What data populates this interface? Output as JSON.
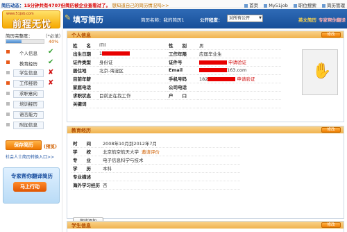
{
  "topbar": {
    "news_label": "简历动态：",
    "news_highlight": "15分钟共有4707份简历被企业查看过了。",
    "news_hint": "想知道自己的简历情况吗>>",
    "links": [
      "首页",
      "My51job",
      "职位搜索",
      "简历管理"
    ]
  },
  "sidebar": {
    "logo_site": "www.51job.com",
    "logo_brand": "前程无忧",
    "completion_label": "简历完整度：",
    "completion_required": "（*必填）",
    "progress": 0.4,
    "progress_text": "40%",
    "items": [
      {
        "label": "个人信息",
        "required": true,
        "status": "✔"
      },
      {
        "label": "教育经历",
        "required": true,
        "status": "✔"
      },
      {
        "label": "学生信息",
        "required": false,
        "status": "✘"
      },
      {
        "label": "工作经验",
        "required": true,
        "status": "✘"
      },
      {
        "label": "求职意向",
        "required": false,
        "status": ""
      },
      {
        "label": "培训经历",
        "required": false,
        "status": ""
      },
      {
        "label": "语言能力",
        "required": false,
        "status": ""
      },
      {
        "label": "附加信息",
        "required": false,
        "status": ""
      }
    ],
    "save_button": "保存简历",
    "preview_link": "(预览)",
    "social_link": "社会人士简历转换入口>>",
    "ad_title": "专家帮你翻译简历",
    "ad_button": "马上行动"
  },
  "header": {
    "title": "填写简历",
    "resume_name_label": "简历名称：",
    "resume_name": "我的简历1",
    "public_label": "公开程度：",
    "public_value": "对所有公开",
    "english_resume": "英文简历",
    "expert_help": "专家帮你翻译"
  },
  "personal": {
    "section_title": "个人信息",
    "edit_label": "修改",
    "rows": [
      {
        "k1": "姓　　名",
        "v1": "ITIl",
        "k2": "性　　别",
        "v2": "男"
      },
      {
        "k1": "出生日期",
        "v1": "1",
        "k2": "工作年限",
        "v2": "应届毕业生"
      },
      {
        "k1": "证件类型",
        "v1": "身份证",
        "k2": "证件号",
        "v2": ""
      },
      {
        "k1": "居住地",
        "v1": "北京-海淀区",
        "k2": "Email",
        "v2": "163.com"
      },
      {
        "k1": "目前年薪",
        "v1": "",
        "k2": "手机号码",
        "v2": "182"
      },
      {
        "k1": "家庭电话",
        "v1": "",
        "k2": "公司电话",
        "v2": ""
      },
      {
        "k1": "求职状态",
        "v1": "目前正在找工作",
        "k2": "户　　口",
        "v2": ""
      },
      {
        "k1": "关键词",
        "v1": "",
        "k2": "",
        "v2": ""
      }
    ],
    "verify_label": "申请验证"
  },
  "education": {
    "section_title": "教育经历",
    "edit_label": "修改",
    "rows": [
      {
        "k": "时　　间",
        "v": "2008年10月到2012年7月"
      },
      {
        "k": "学　　校",
        "v": "北京航空航天大学",
        "extra": "邀请评价"
      },
      {
        "k": "专　　业",
        "v": "电子信息科学与技术"
      },
      {
        "k": "学　　历",
        "v": "本科"
      },
      {
        "k": "专业描述",
        "v": ""
      },
      {
        "k": "海外学习经历",
        "v": "否"
      }
    ],
    "add_button": "继续添加"
  },
  "student": {
    "section_title": "学生信息",
    "edit_label": "修改"
  }
}
